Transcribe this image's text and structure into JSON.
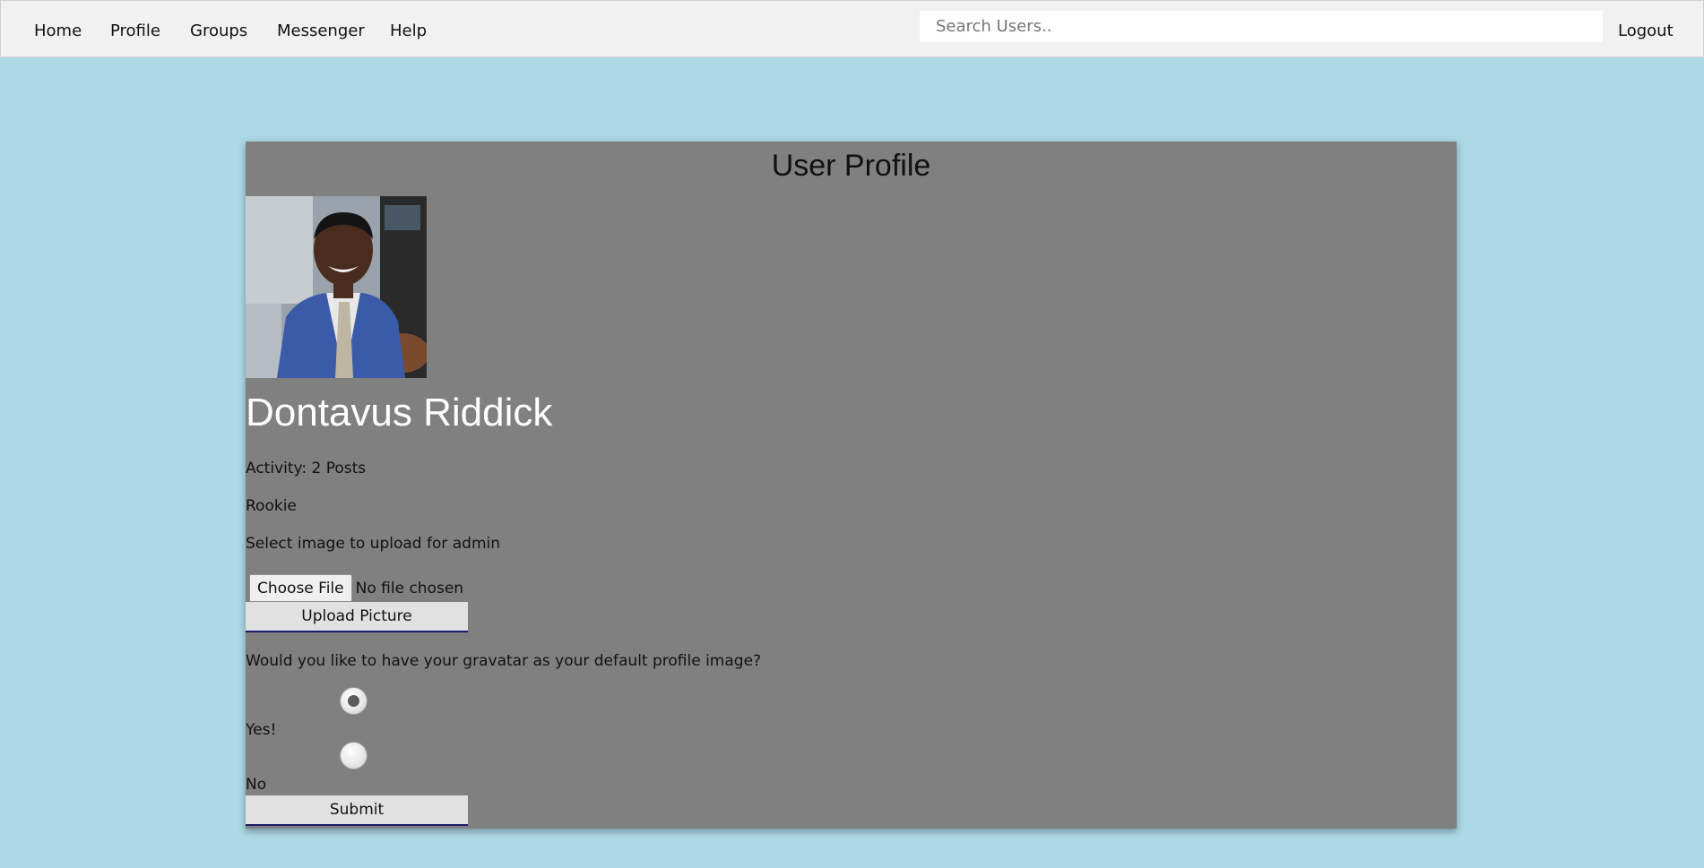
{
  "nav": {
    "home": "Home",
    "profile": "Profile",
    "groups": "Groups",
    "messenger": "Messenger",
    "help": "Help",
    "logout": "Logout",
    "search_placeholder": "Search Users.."
  },
  "profile": {
    "title": "User Profile",
    "name": "Dontavus Riddick",
    "activity": "Activity: 2 Posts",
    "rank": "Rookie",
    "upload_prompt": "Select image to upload for admin",
    "choose_file": "Choose File",
    "file_status": "No file chosen",
    "upload_button": "Upload Picture",
    "gravatar_question": "Would you like to have your gravatar as your default profile image?",
    "option_yes": "Yes!",
    "option_no": "No",
    "submit_button": "Submit",
    "selected_option": "yes"
  },
  "colors": {
    "background": "#add8e6",
    "navbar": "#f1f1f1",
    "card": "#808080",
    "name_text": "#ffffff"
  },
  "icons": {
    "avatar": "user-photo"
  }
}
